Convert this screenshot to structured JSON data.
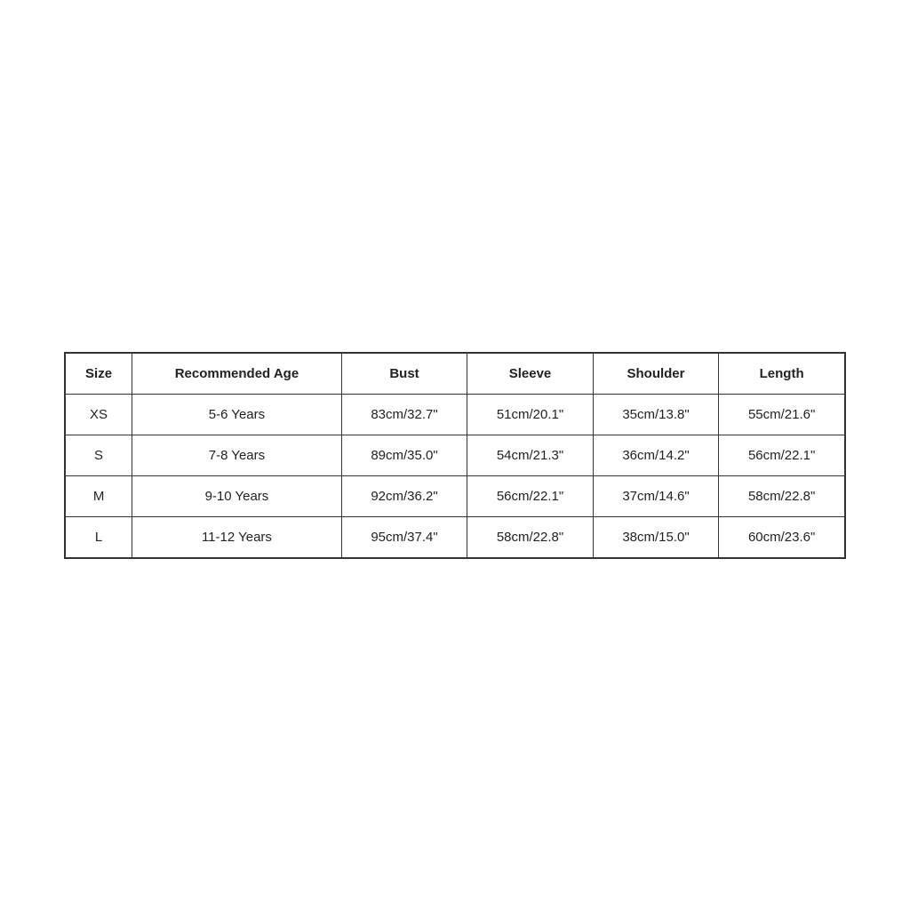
{
  "table": {
    "headers": [
      "Size",
      "Recommended Age",
      "Bust",
      "Sleeve",
      "Shoulder",
      "Length"
    ],
    "rows": [
      {
        "size": "XS",
        "age": "5-6 Years",
        "bust": "83cm/32.7\"",
        "sleeve": "51cm/20.1\"",
        "shoulder": "35cm/13.8\"",
        "length": "55cm/21.6\""
      },
      {
        "size": "S",
        "age": "7-8 Years",
        "bust": "89cm/35.0\"",
        "sleeve": "54cm/21.3\"",
        "shoulder": "36cm/14.2\"",
        "length": "56cm/22.1\""
      },
      {
        "size": "M",
        "age": "9-10 Years",
        "bust": "92cm/36.2\"",
        "sleeve": "56cm/22.1\"",
        "shoulder": "37cm/14.6\"",
        "length": "58cm/22.8\""
      },
      {
        "size": "L",
        "age": "11-12 Years",
        "bust": "95cm/37.4\"",
        "sleeve": "58cm/22.8\"",
        "shoulder": "38cm/15.0\"",
        "length": "60cm/23.6\""
      }
    ]
  }
}
